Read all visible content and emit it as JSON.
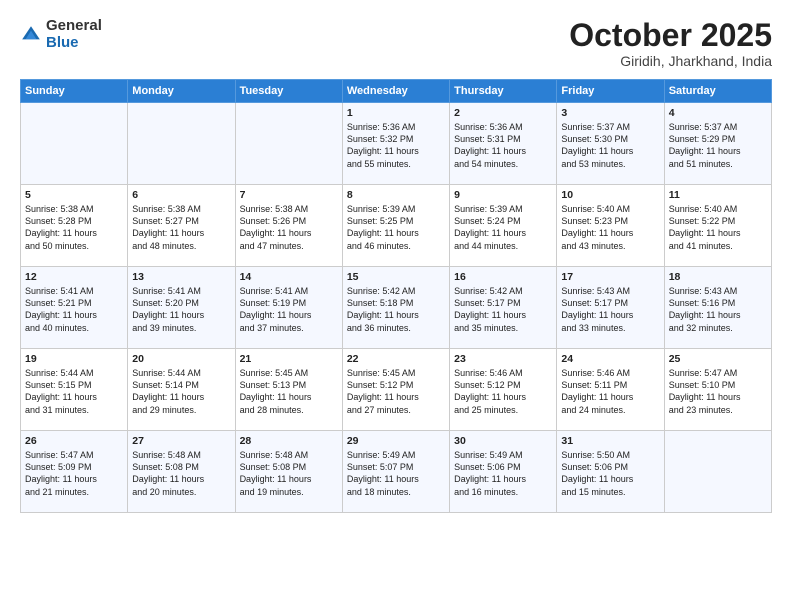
{
  "logo": {
    "general": "General",
    "blue": "Blue"
  },
  "header": {
    "month": "October 2025",
    "location": "Giridih, Jharkhand, India"
  },
  "weekdays": [
    "Sunday",
    "Monday",
    "Tuesday",
    "Wednesday",
    "Thursday",
    "Friday",
    "Saturday"
  ],
  "weeks": [
    [
      {
        "day": "",
        "info": ""
      },
      {
        "day": "",
        "info": ""
      },
      {
        "day": "",
        "info": ""
      },
      {
        "day": "1",
        "info": "Sunrise: 5:36 AM\nSunset: 5:32 PM\nDaylight: 11 hours\nand 55 minutes."
      },
      {
        "day": "2",
        "info": "Sunrise: 5:36 AM\nSunset: 5:31 PM\nDaylight: 11 hours\nand 54 minutes."
      },
      {
        "day": "3",
        "info": "Sunrise: 5:37 AM\nSunset: 5:30 PM\nDaylight: 11 hours\nand 53 minutes."
      },
      {
        "day": "4",
        "info": "Sunrise: 5:37 AM\nSunset: 5:29 PM\nDaylight: 11 hours\nand 51 minutes."
      }
    ],
    [
      {
        "day": "5",
        "info": "Sunrise: 5:38 AM\nSunset: 5:28 PM\nDaylight: 11 hours\nand 50 minutes."
      },
      {
        "day": "6",
        "info": "Sunrise: 5:38 AM\nSunset: 5:27 PM\nDaylight: 11 hours\nand 48 minutes."
      },
      {
        "day": "7",
        "info": "Sunrise: 5:38 AM\nSunset: 5:26 PM\nDaylight: 11 hours\nand 47 minutes."
      },
      {
        "day": "8",
        "info": "Sunrise: 5:39 AM\nSunset: 5:25 PM\nDaylight: 11 hours\nand 46 minutes."
      },
      {
        "day": "9",
        "info": "Sunrise: 5:39 AM\nSunset: 5:24 PM\nDaylight: 11 hours\nand 44 minutes."
      },
      {
        "day": "10",
        "info": "Sunrise: 5:40 AM\nSunset: 5:23 PM\nDaylight: 11 hours\nand 43 minutes."
      },
      {
        "day": "11",
        "info": "Sunrise: 5:40 AM\nSunset: 5:22 PM\nDaylight: 11 hours\nand 41 minutes."
      }
    ],
    [
      {
        "day": "12",
        "info": "Sunrise: 5:41 AM\nSunset: 5:21 PM\nDaylight: 11 hours\nand 40 minutes."
      },
      {
        "day": "13",
        "info": "Sunrise: 5:41 AM\nSunset: 5:20 PM\nDaylight: 11 hours\nand 39 minutes."
      },
      {
        "day": "14",
        "info": "Sunrise: 5:41 AM\nSunset: 5:19 PM\nDaylight: 11 hours\nand 37 minutes."
      },
      {
        "day": "15",
        "info": "Sunrise: 5:42 AM\nSunset: 5:18 PM\nDaylight: 11 hours\nand 36 minutes."
      },
      {
        "day": "16",
        "info": "Sunrise: 5:42 AM\nSunset: 5:17 PM\nDaylight: 11 hours\nand 35 minutes."
      },
      {
        "day": "17",
        "info": "Sunrise: 5:43 AM\nSunset: 5:17 PM\nDaylight: 11 hours\nand 33 minutes."
      },
      {
        "day": "18",
        "info": "Sunrise: 5:43 AM\nSunset: 5:16 PM\nDaylight: 11 hours\nand 32 minutes."
      }
    ],
    [
      {
        "day": "19",
        "info": "Sunrise: 5:44 AM\nSunset: 5:15 PM\nDaylight: 11 hours\nand 31 minutes."
      },
      {
        "day": "20",
        "info": "Sunrise: 5:44 AM\nSunset: 5:14 PM\nDaylight: 11 hours\nand 29 minutes."
      },
      {
        "day": "21",
        "info": "Sunrise: 5:45 AM\nSunset: 5:13 PM\nDaylight: 11 hours\nand 28 minutes."
      },
      {
        "day": "22",
        "info": "Sunrise: 5:45 AM\nSunset: 5:12 PM\nDaylight: 11 hours\nand 27 minutes."
      },
      {
        "day": "23",
        "info": "Sunrise: 5:46 AM\nSunset: 5:12 PM\nDaylight: 11 hours\nand 25 minutes."
      },
      {
        "day": "24",
        "info": "Sunrise: 5:46 AM\nSunset: 5:11 PM\nDaylight: 11 hours\nand 24 minutes."
      },
      {
        "day": "25",
        "info": "Sunrise: 5:47 AM\nSunset: 5:10 PM\nDaylight: 11 hours\nand 23 minutes."
      }
    ],
    [
      {
        "day": "26",
        "info": "Sunrise: 5:47 AM\nSunset: 5:09 PM\nDaylight: 11 hours\nand 21 minutes."
      },
      {
        "day": "27",
        "info": "Sunrise: 5:48 AM\nSunset: 5:08 PM\nDaylight: 11 hours\nand 20 minutes."
      },
      {
        "day": "28",
        "info": "Sunrise: 5:48 AM\nSunset: 5:08 PM\nDaylight: 11 hours\nand 19 minutes."
      },
      {
        "day": "29",
        "info": "Sunrise: 5:49 AM\nSunset: 5:07 PM\nDaylight: 11 hours\nand 18 minutes."
      },
      {
        "day": "30",
        "info": "Sunrise: 5:49 AM\nSunset: 5:06 PM\nDaylight: 11 hours\nand 16 minutes."
      },
      {
        "day": "31",
        "info": "Sunrise: 5:50 AM\nSunset: 5:06 PM\nDaylight: 11 hours\nand 15 minutes."
      },
      {
        "day": "",
        "info": ""
      }
    ]
  ]
}
